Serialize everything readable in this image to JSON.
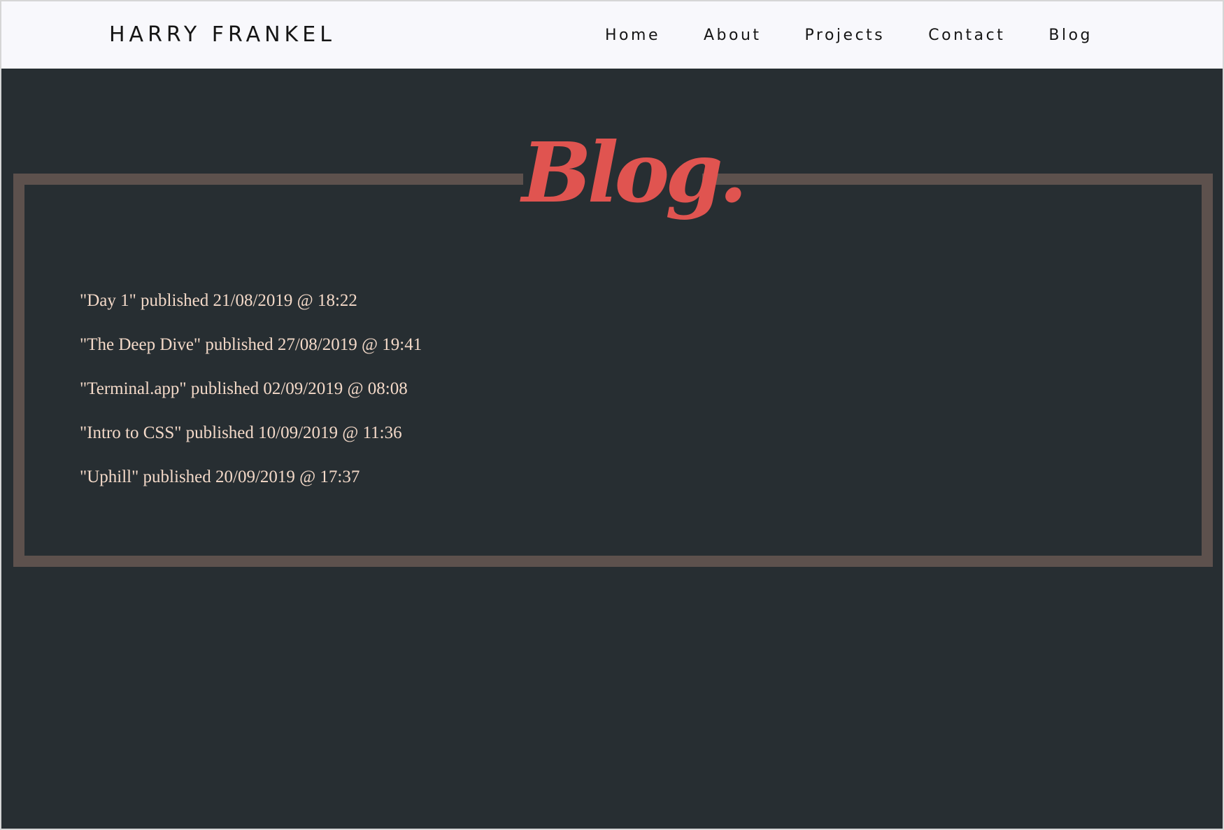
{
  "header": {
    "brand": "HARRY FRANKEL",
    "nav": [
      {
        "label": "Home"
      },
      {
        "label": "About"
      },
      {
        "label": "Projects"
      },
      {
        "label": "Contact"
      },
      {
        "label": "Blog"
      }
    ]
  },
  "main": {
    "title": "Blog.",
    "posts": [
      {
        "text": "\"Day 1\" published 21/08/2019 @ 18:22"
      },
      {
        "text": "\"The Deep Dive\" published 27/08/2019 @ 19:41"
      },
      {
        "text": "\"Terminal.app\" published 02/09/2019 @ 08:08"
      },
      {
        "text": "\"Intro to CSS\" published 10/09/2019 @ 11:36"
      },
      {
        "text": "\"Uphill\" published 20/09/2019 @ 17:37"
      }
    ]
  },
  "colors": {
    "background": "#272e32",
    "navbar": "#f8f8fc",
    "accent": "#e05450",
    "frame": "#5d514d",
    "post_text": "#f3d9c8"
  }
}
